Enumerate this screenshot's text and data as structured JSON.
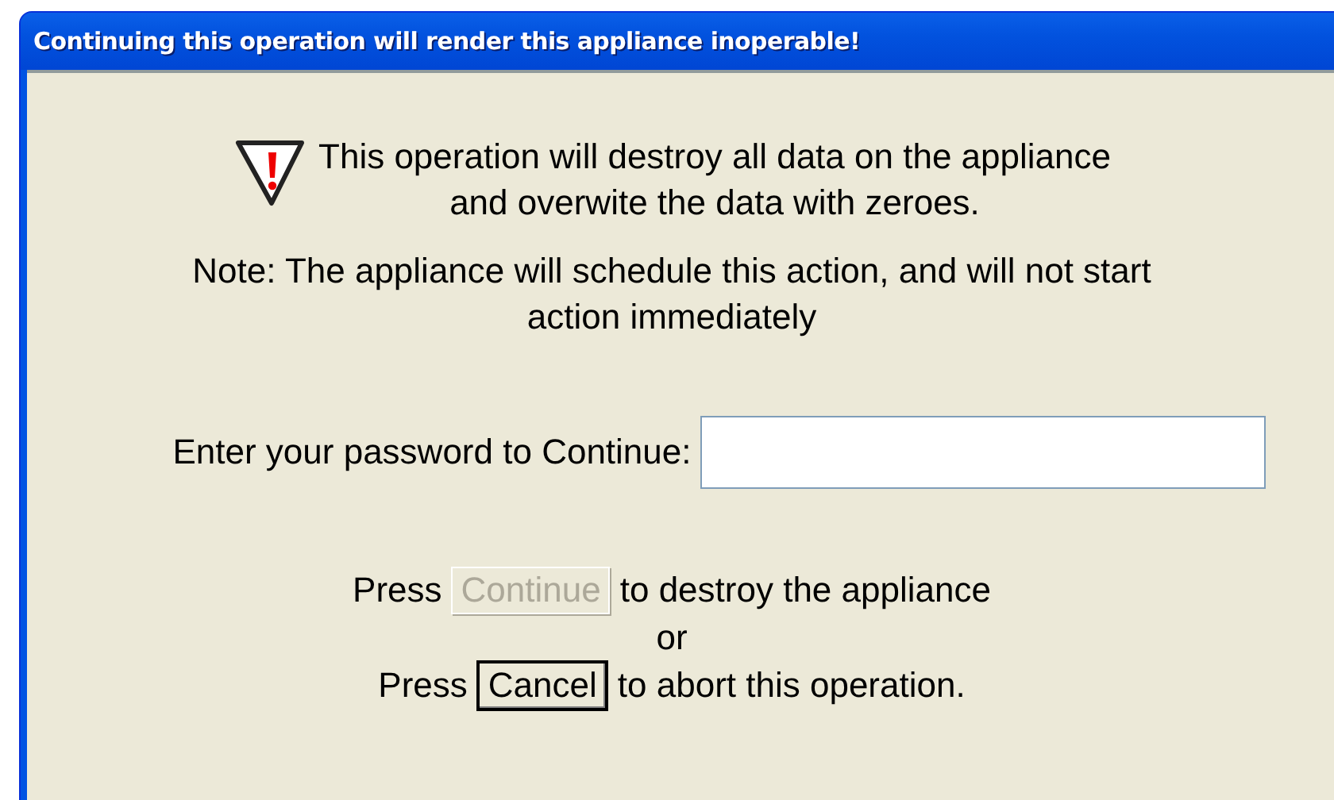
{
  "window": {
    "title": "Continuing this operation will render this appliance inoperable!"
  },
  "warning": {
    "lines": [
      "This operation will destroy all data on the appliance",
      "and overwite the data with zeroes."
    ]
  },
  "note": {
    "lines": [
      "Note:  The appliance will schedule this action, and will not start",
      "action immediately"
    ]
  },
  "password": {
    "label": "Enter your password to Continue:"
  },
  "actions": [
    {
      "prefix": "Press",
      "button": "Continue",
      "disabled": true,
      "focused": false,
      "suffix": "to destroy the appliance"
    },
    {
      "prefix": "Press",
      "button": "Cancel",
      "disabled": false,
      "focused": true,
      "suffix": "to abort this operation."
    }
  ],
  "separator": "or"
}
